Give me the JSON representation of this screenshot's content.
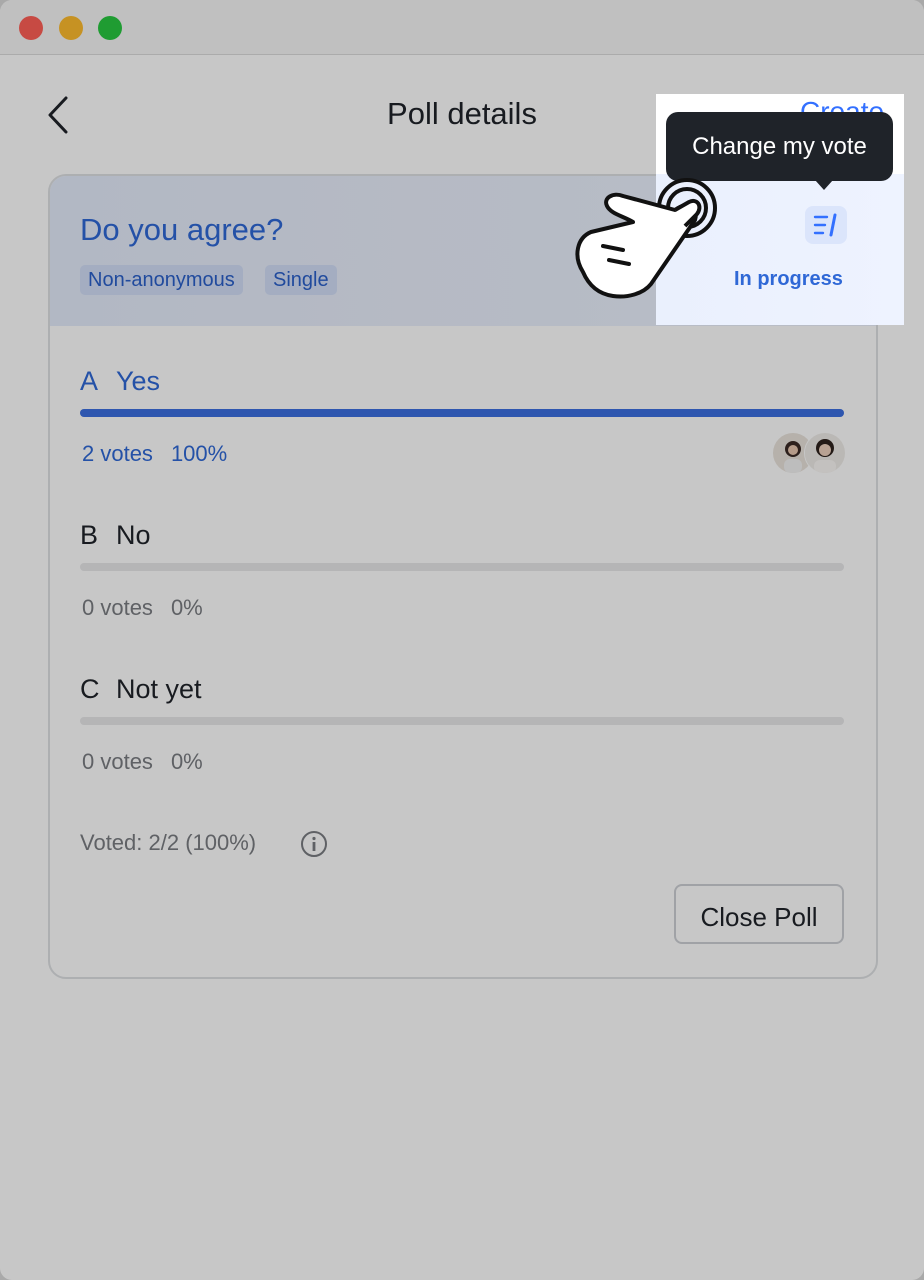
{
  "header": {
    "title": "Poll details",
    "create_link": "Create"
  },
  "poll": {
    "question": "Do you agree?",
    "tags": [
      "Non-anonymous",
      "Single"
    ],
    "status": "In progress",
    "options": [
      {
        "letter": "A",
        "label": "Yes",
        "votes": "2 votes",
        "percent": "100%",
        "fill": 1.0,
        "selected": true
      },
      {
        "letter": "B",
        "label": "No",
        "votes": "0 votes",
        "percent": "0%",
        "fill": 0.0,
        "selected": false
      },
      {
        "letter": "C",
        "label": "Not yet",
        "votes": "0 votes",
        "percent": "0%",
        "fill": 0.0,
        "selected": false
      }
    ],
    "voted_summary": "Voted: 2/2 (100%)",
    "close_button": "Close Poll"
  },
  "tooltip": {
    "text": "Change my vote"
  },
  "colors": {
    "accent": "#3b6fe0",
    "selected_text": "#2f68d6",
    "muted_text": "#7a7d82"
  }
}
